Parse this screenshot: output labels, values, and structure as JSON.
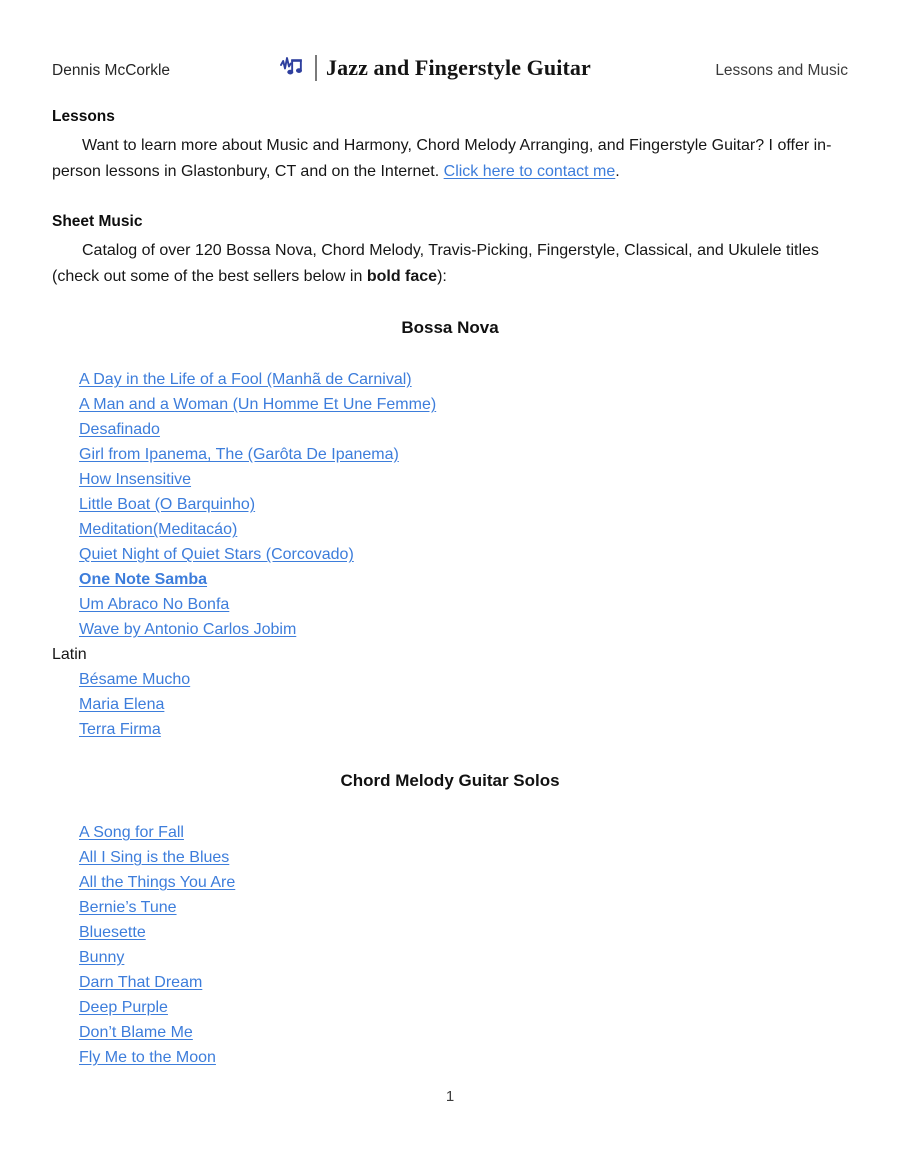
{
  "header": {
    "author": "Dennis McCorkle",
    "logo_icon": "music-note-waveform-icon",
    "title": "Jazz and Fingerstyle Guitar",
    "right_text": "Lessons and Music"
  },
  "lessons": {
    "heading": "Lessons",
    "paragraph_before": "Want to learn more about Music and Harmony, Chord Melody Arranging, and Fingerstyle Guitar? I offer in-person lessons in Glastonbury, CT and on the Internet. ",
    "contact_link": "Click here to contact me",
    "paragraph_after": "."
  },
  "sheet_music": {
    "heading": "Sheet Music",
    "intro_before": "Catalog of over 120 Bossa Nova, Chord Melody, Travis-Picking, Fingerstyle, Classical, and Ukulele titles (check out some of the best sellers below in ",
    "intro_bold": "bold face",
    "intro_after": "):"
  },
  "sections": [
    {
      "title": "Bossa Nova",
      "songs": [
        {
          "title": "A Day in the Life of a Fool (Manhã de Carnival)",
          "best_seller": false
        },
        {
          "title": "A Man and a Woman (Un Homme Et Une Femme)",
          "best_seller": false
        },
        {
          "title": "Desafinado",
          "best_seller": false
        },
        {
          "title": "Girl from Ipanema, The (Garôta De Ipanema)",
          "best_seller": false
        },
        {
          "title": "How Insensitive",
          "best_seller": false
        },
        {
          "title": "Little Boat (O Barquinho)",
          "best_seller": false
        },
        {
          "title": "Meditation(Meditacáo)",
          "best_seller": false
        },
        {
          "title": "Quiet Night of Quiet Stars (Corcovado)",
          "best_seller": false
        },
        {
          "title": "One Note Samba",
          "best_seller": true
        },
        {
          "title": "Um Abraco No Bonfa",
          "best_seller": false
        },
        {
          "title": "Wave by Antonio Carlos Jobim",
          "best_seller": false
        }
      ],
      "subgroup": {
        "label": "Latin",
        "songs": [
          {
            "title": "Bésame Mucho",
            "best_seller": false
          },
          {
            "title": "Maria Elena",
            "best_seller": false
          },
          {
            "title": "Terra Firma",
            "best_seller": false
          }
        ]
      }
    },
    {
      "title": "Chord Melody Guitar Solos",
      "songs": [
        {
          "title": "A Song for Fall",
          "best_seller": false
        },
        {
          "title": "All I Sing is the Blues",
          "best_seller": false
        },
        {
          "title": "All the Things You Are",
          "best_seller": false
        },
        {
          "title": "Bernie’s Tune",
          "best_seller": false
        },
        {
          "title": "Bluesette",
          "best_seller": false
        },
        {
          "title": "Bunny",
          "best_seller": false
        },
        {
          "title": "Darn That Dream",
          "best_seller": false
        },
        {
          "title": "Deep Purple",
          "best_seller": false
        },
        {
          "title": "Don’t Blame Me",
          "best_seller": false
        },
        {
          "title": "Fly Me to the Moon",
          "best_seller": false
        }
      ],
      "subgroup": null
    }
  ],
  "footer": {
    "page_number": "1"
  },
  "colors": {
    "link": "#3d7ddb",
    "logo": "#2e3f9e",
    "text": "#161616"
  }
}
